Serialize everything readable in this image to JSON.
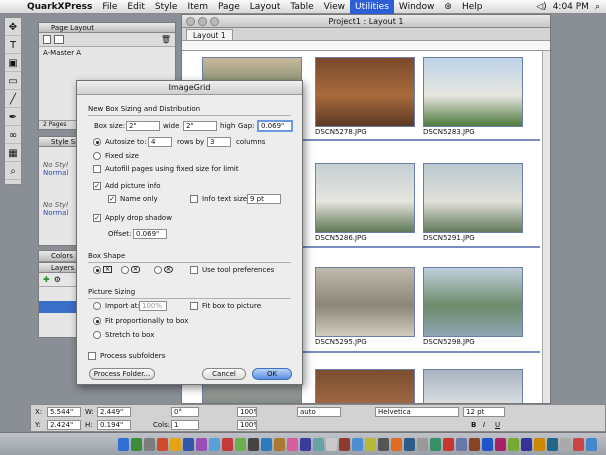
{
  "menubar": {
    "app_name": "QuarkXPress",
    "items": [
      "File",
      "Edit",
      "Style",
      "Item",
      "Page",
      "Layout",
      "Table",
      "View",
      "Utilities",
      "Window",
      "Help"
    ],
    "active_item": "Utilities",
    "clock": "4:04 PM",
    "apple_glyph": "",
    "help_glyph": "⊛"
  },
  "palettes": {
    "page_layout_title": "Page Layout",
    "master": "A-Master A",
    "pages_count": "2 Pages",
    "style_sheets_title": "Style Sh",
    "style_items": [
      "No Styl",
      "Normal"
    ],
    "char_items": [
      "No Styl",
      "Normal"
    ],
    "colors_title": "Colors",
    "layers_title": "Layers"
  },
  "document": {
    "title": "Project1 : Layout 1",
    "tab": "Layout 1",
    "photos": [
      {
        "label": "",
        "colors": [
          "#c9b99a",
          "#6a7f66",
          "#a3927a"
        ]
      },
      {
        "label": "DSCN5278.JPG",
        "colors": [
          "#7b4a2c",
          "#a86a3c",
          "#5b3a24"
        ]
      },
      {
        "label": "DSCN5283.JPG",
        "colors": [
          "#bdd3e8",
          "#e8e6e0",
          "#4f7a3d"
        ]
      },
      {
        "label": "",
        "colors": [
          "#9aa4a8",
          "#b7bcb9",
          "#6f7a6e"
        ]
      },
      {
        "label": "DSCN5286.JPG",
        "colors": [
          "#c4cfd3",
          "#e7e5df",
          "#5e7756"
        ]
      },
      {
        "label": "DSCN5291.JPG",
        "colors": [
          "#b9c8cf",
          "#e1e0da",
          "#62795a"
        ]
      },
      {
        "label": "",
        "colors": [
          "#7d7f78",
          "#a4a59c",
          "#545a4f"
        ]
      },
      {
        "label": "DSCN5295.JPG",
        "colors": [
          "#bfb9ac",
          "#8b8679",
          "#d1ccc0"
        ]
      },
      {
        "label": "DSCN5298.JPG",
        "colors": [
          "#bfd0dc",
          "#6d8a6a",
          "#8fa6b4"
        ]
      },
      {
        "label": "",
        "colors": [
          "#b1b6b4",
          "#7e8580",
          "#c9cbc6"
        ]
      },
      {
        "label": "",
        "colors": [
          "#7b4d31",
          "#a36a44",
          "#5e3b26"
        ]
      },
      {
        "label": "",
        "colors": [
          "#a7b3c0",
          "#e0e3e5",
          "#7d8a94"
        ]
      }
    ]
  },
  "dialog": {
    "title": "ImageGrid",
    "section_box_sizing": "New Box Sizing and Distribution",
    "box_size_label": "Box size:",
    "box_width": "2\"",
    "wide_label": "wide",
    "box_height": "2\"",
    "high_label": "high",
    "gap_label": "Gap:",
    "gap_value": "0.069\"",
    "autosize_label": "Autosize to:",
    "autosize_rows": "4",
    "rows_by_label": "rows by",
    "autosize_cols": "3",
    "columns_label": "columns",
    "fixed_size_label": "Fixed size",
    "autofill_label": "Autofill pages using fixed size for limit",
    "add_picture_info_label": "Add picture info",
    "name_only_label": "Name only",
    "info_text_size_label": "Info text size",
    "info_text_size_value": "9 pt",
    "drop_shadow_label": "Apply drop shadow",
    "offset_label": "Offset:",
    "offset_value": "0.069\"",
    "section_box_shape": "Box Shape",
    "shape_square": "✕",
    "shape_rounded": "✕",
    "shape_oval": "✕",
    "use_tool_prefs_label": "Use tool preferences",
    "section_picture_sizing": "Picture Sizing",
    "import_at_label": "Import at:",
    "import_at_value": "100%",
    "fit_box_label": "Fit box to picture",
    "fit_prop_label": "Fit proportionally to box",
    "stretch_label": "Stretch to box",
    "process_sub_label": "Process subfolders",
    "process_folder_btn": "Process Folder...",
    "cancel_btn": "Cancel",
    "ok_btn": "OK",
    "autosize_selected": true,
    "add_picture_info_checked": true,
    "name_only_checked": true,
    "drop_shadow_checked": true,
    "fit_prop_selected": true,
    "square_selected": true
  },
  "measurements": {
    "x_label": "X:",
    "x_value": "5.544\"",
    "y_label": "Y:",
    "y_value": "2.424\"",
    "w_label": "W:",
    "w_value": "2.449\"",
    "h_label": "H:",
    "h_value": "0.194\"",
    "angle_value": "0°",
    "cols_label": "Cols:",
    "cols_value": "1",
    "scale1": "100%",
    "scale2": "100%",
    "tracking": "auto",
    "font": "Helvetica",
    "size": "12 pt",
    "bold": "B",
    "italic": "I",
    "underline": "U"
  },
  "dock_colors": [
    "#2f6fd6",
    "#3c8a3b",
    "#7d7d7d",
    "#d04b2a",
    "#e2a317",
    "#3355aa",
    "#9a4fb5",
    "#5aa0d8",
    "#c43a3a",
    "#6bb04e",
    "#444",
    "#2e7abf",
    "#aa7a33",
    "#d65d9e",
    "#3b3b9e",
    "#67a3a3",
    "#c9c9c9",
    "#8f3b2b",
    "#4c8fd1",
    "#b8b838",
    "#555",
    "#e06b22",
    "#2d5b8a",
    "#999",
    "#3a8f6b",
    "#c7372f",
    "#6677aa",
    "#884422",
    "#2255cc",
    "#aa2266",
    "#77aa33",
    "#333399",
    "#cc8800",
    "#226688",
    "#aaaaaa",
    "#cc4444",
    "#4488cc"
  ]
}
